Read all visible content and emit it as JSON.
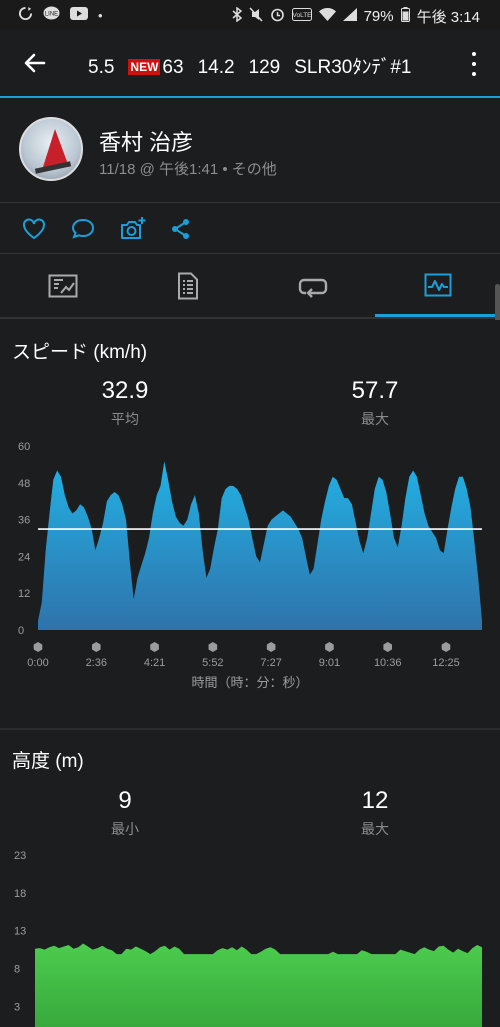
{
  "status_bar": {
    "battery": "79%",
    "time": "午後 3:14"
  },
  "toolbar": {
    "title_items": [
      "5.5",
      "63",
      "14.2",
      "129",
      "SLR30ﾀﾝﾃﾞ#1"
    ],
    "new_badge": "NEW"
  },
  "profile": {
    "name": "香村 治彦",
    "meta": "11/18 @ 午後1:41 • その他"
  },
  "speed": {
    "title": "スピード (km/h)",
    "avg_value": "32.9",
    "avg_label": "平均",
    "max_value": "57.7",
    "max_label": "最大",
    "x_axis_label": "時間（時：分：秒）"
  },
  "altitude": {
    "title": "高度 (m)",
    "min_value": "9",
    "min_label": "最小",
    "max_value": "12",
    "max_label": "最大"
  },
  "chart_data": [
    {
      "type": "area",
      "title": "スピード (km/h)",
      "xlabel": "時間（時：分：秒）",
      "ylabel": "",
      "ylim": [
        0,
        60
      ],
      "y_ticks": [
        0,
        12,
        24,
        36,
        48,
        60
      ],
      "x_ticks": [
        "0:00",
        "2:36",
        "4:21",
        "5:52",
        "7:27",
        "9:01",
        "10:36",
        "12:25"
      ],
      "reference_line": 32.9,
      "color": "#1fa6d9",
      "series": [
        {
          "values": [
            3,
            9,
            26,
            38,
            49,
            52,
            50,
            44,
            40,
            38,
            39,
            41,
            40,
            37,
            33,
            26,
            30,
            35,
            42,
            44,
            45,
            44,
            41,
            36,
            22,
            10,
            17,
            21,
            25,
            30,
            38,
            44,
            47,
            55,
            49,
            42,
            37,
            35,
            34,
            36,
            41,
            44,
            38,
            26,
            17,
            20,
            27,
            33,
            43,
            46,
            47,
            47,
            46,
            44,
            40,
            36,
            30,
            24,
            22,
            28,
            34,
            36,
            37,
            38,
            39,
            38,
            37,
            35,
            33,
            30,
            24,
            18,
            20,
            28,
            36,
            42,
            47,
            50,
            49,
            46,
            43,
            43,
            41,
            35,
            29,
            25,
            30,
            38,
            46,
            50,
            49,
            45,
            38,
            30,
            27,
            34,
            43,
            50,
            52,
            50,
            44,
            38,
            34,
            32,
            30,
            26,
            25,
            33,
            40,
            46,
            50,
            50,
            46,
            40,
            29,
            17,
            3
          ]
        }
      ]
    },
    {
      "type": "area",
      "title": "高度 (m)",
      "ylim": [
        0,
        23
      ],
      "y_ticks": [
        3,
        8,
        13,
        18,
        23
      ],
      "color": "#3fc043",
      "series": [
        {
          "values": [
            10.6,
            10.7,
            10.5,
            10.8,
            11.0,
            10.7,
            10.9,
            11.1,
            10.6,
            10.8,
            11.3,
            10.9,
            10.5,
            10.7,
            11.0,
            10.6,
            10.4,
            9.9,
            9.9,
            10.6,
            10.5,
            10.9,
            10.6,
            10.3,
            9.9,
            10.3,
            10.8,
            11.0,
            10.5,
            10.9,
            10.6,
            9.9,
            9.9,
            9.9,
            9.9,
            9.9,
            9.9,
            9.9,
            10.4,
            10.7,
            10.5,
            10.8,
            10.4,
            10.9,
            10.5,
            9.9,
            9.9,
            10.2,
            10.6,
            10.8,
            10.5,
            9.9,
            9.9,
            9.9,
            9.9,
            9.9,
            9.9,
            9.9,
            9.9,
            9.9,
            9.9,
            9.9,
            10.2,
            9.9,
            9.9,
            9.9,
            9.9,
            9.9,
            10.4,
            10.2,
            9.9,
            9.9,
            9.9,
            9.9,
            9.9,
            9.9,
            10.5,
            10.3,
            10.1,
            9.9,
            10.5,
            10.8,
            10.5,
            10.3,
            10.9,
            11.0,
            10.5,
            10.1,
            10.6,
            10.3,
            10.0,
            10.7,
            11.1,
            10.8
          ]
        }
      ]
    }
  ]
}
